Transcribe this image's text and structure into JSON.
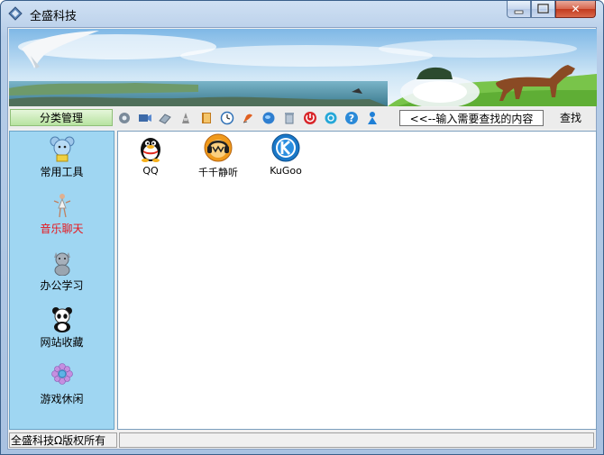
{
  "window": {
    "title": "全盛科技",
    "min_label": "",
    "max_label": "",
    "close_label": "✕"
  },
  "toolbar": {
    "category_header": "分类管理",
    "icons": [
      "gear-icon",
      "camera-icon",
      "eraser-icon",
      "cleaner-icon",
      "book-icon",
      "clock-icon",
      "pen-icon",
      "globe-icon",
      "trash-icon",
      "power-icon",
      "network-icon",
      "help-icon",
      "person-icon"
    ],
    "search_value": "<<--输入需要查找的内容",
    "search_label": "查找"
  },
  "sidebar": {
    "items": [
      {
        "label": "常用工具",
        "icon": "mouse-character-icon",
        "active": false
      },
      {
        "label": "音乐聊天",
        "icon": "dancer-icon",
        "active": true
      },
      {
        "label": "办公学习",
        "icon": "cat-icon",
        "active": false
      },
      {
        "label": "网站收藏",
        "icon": "panda-icon",
        "active": false
      },
      {
        "label": "游戏休闲",
        "icon": "flower-icon",
        "active": false
      }
    ]
  },
  "apps": [
    {
      "label": "QQ",
      "icon": "qq-penguin-icon"
    },
    {
      "label": "千千静听",
      "icon": "ttplayer-icon"
    },
    {
      "label": "KuGoo",
      "icon": "kugoo-icon"
    }
  ],
  "status": {
    "left": "全盛科技Ω版权所有",
    "right": ""
  },
  "colors": {
    "active_category": "#e8151b",
    "sidebar_bg": "#9fd6f2",
    "header_green": "#b7e3a0"
  }
}
